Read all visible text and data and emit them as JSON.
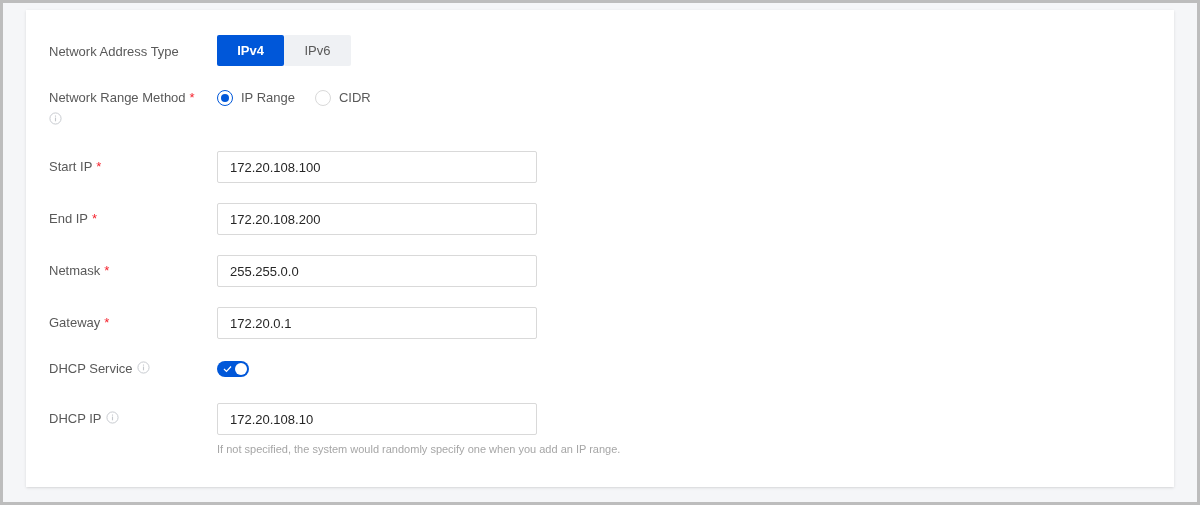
{
  "fields": [
    {
      "kind": "segmented",
      "label": "Network Address Type",
      "info": false,
      "options": [
        {
          "label": "IPv4",
          "selected": true
        },
        {
          "label": "IPv6",
          "selected": false
        }
      ]
    },
    {
      "kind": "radio",
      "label": "Network Range Method",
      "required_mark": "*",
      "info": true,
      "options": [
        {
          "label": "IP Range",
          "selected": true
        },
        {
          "label": "CIDR",
          "selected": false
        }
      ]
    },
    {
      "kind": "input",
      "label": "Start IP",
      "required_mark": "*",
      "info": false,
      "value": "172.20.108.100"
    },
    {
      "kind": "input",
      "label": "End IP",
      "required_mark": "*",
      "info": false,
      "value": "172.20.108.200"
    },
    {
      "kind": "input",
      "label": "Netmask",
      "required_mark": "*",
      "info": false,
      "value": "255.255.0.0"
    },
    {
      "kind": "input",
      "label": "Gateway",
      "required_mark": "*",
      "info": false,
      "value": "172.20.0.1"
    },
    {
      "kind": "switch",
      "label": "DHCP Service",
      "info": true,
      "on": true
    },
    {
      "kind": "input",
      "label": "DHCP IP",
      "info": true,
      "value": "172.20.108.10",
      "hint": "If not specified, the system would randomly specify one when you add an IP range."
    }
  ]
}
